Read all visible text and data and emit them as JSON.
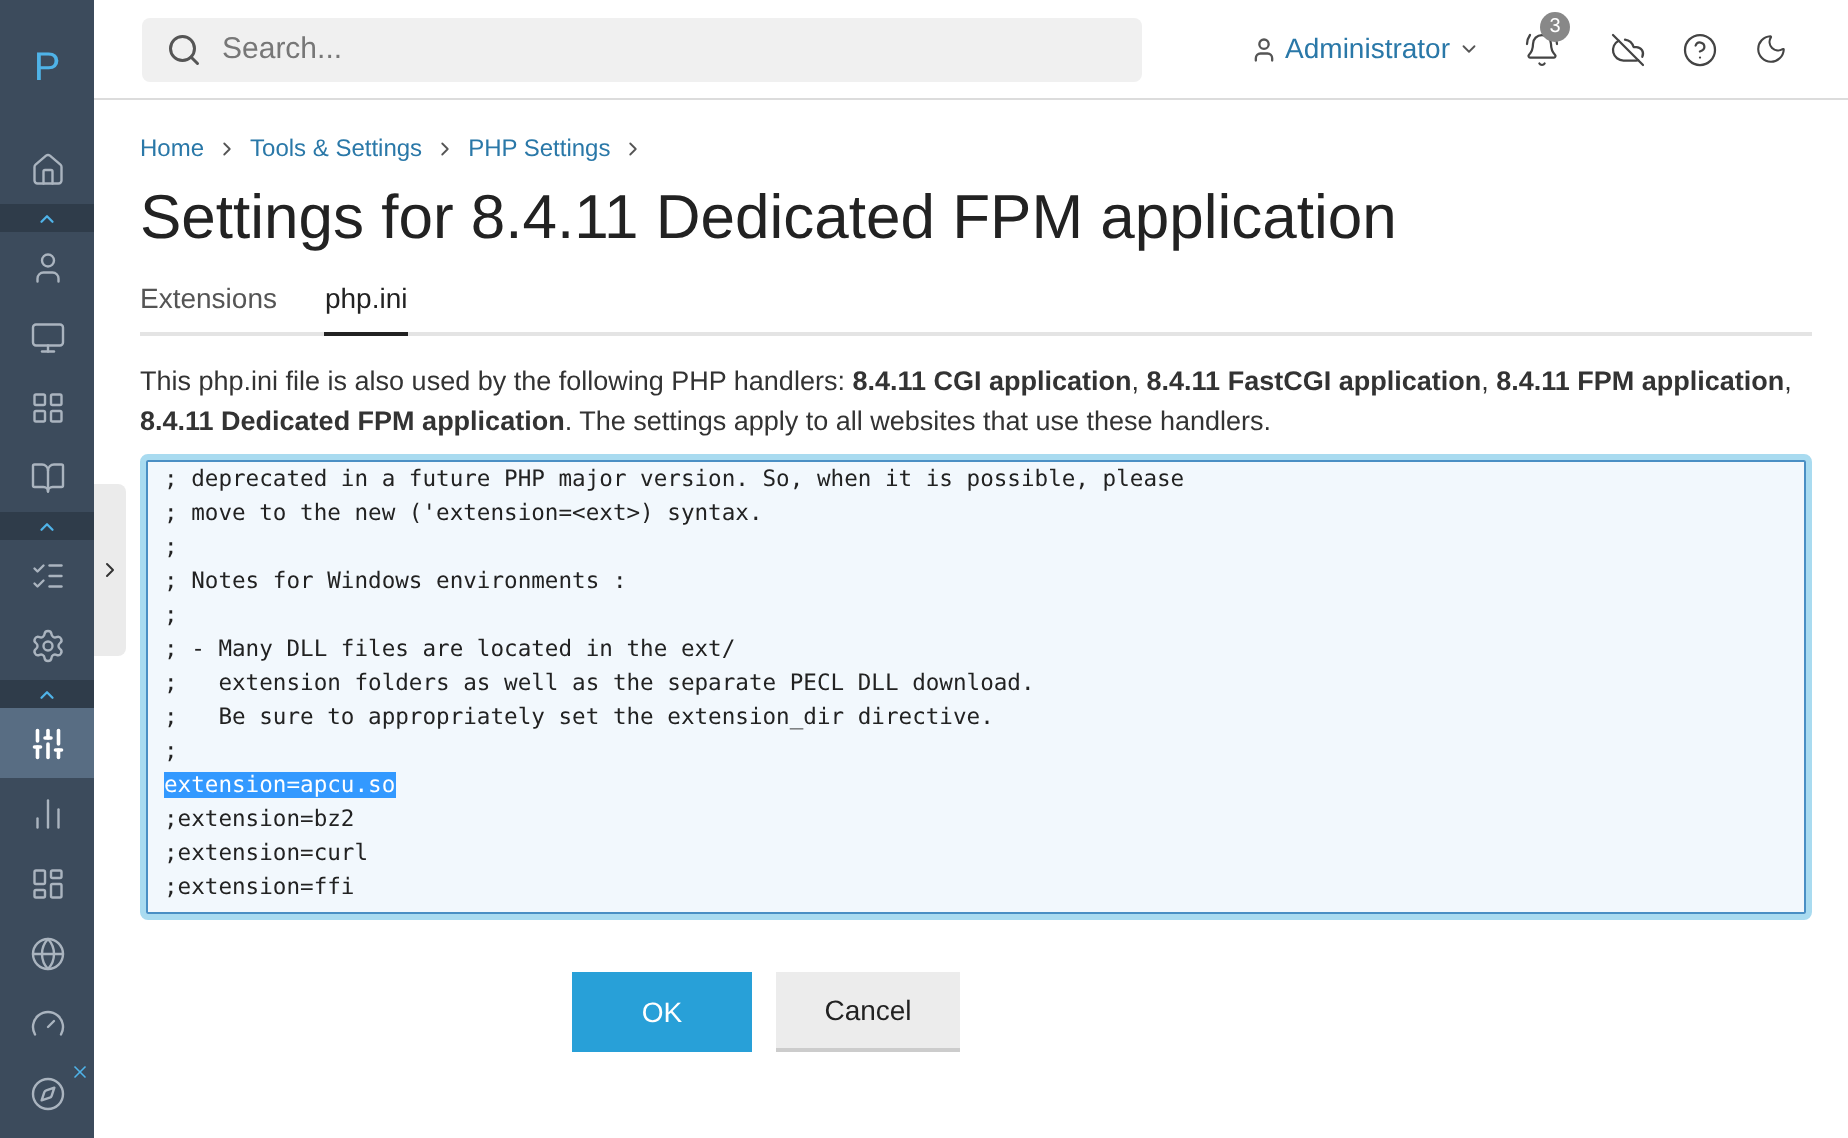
{
  "sidebar": {
    "logo": "P",
    "items": [
      {
        "kind": "nav",
        "selected": false
      },
      {
        "kind": "toggle",
        "selected": false
      },
      {
        "kind": "nav",
        "selected": false
      },
      {
        "kind": "nav",
        "selected": false
      },
      {
        "kind": "nav",
        "selected": false
      },
      {
        "kind": "nav",
        "selected": false
      },
      {
        "kind": "toggle",
        "selected": false
      },
      {
        "kind": "nav",
        "selected": false
      },
      {
        "kind": "nav",
        "selected": false
      },
      {
        "kind": "toggle",
        "selected": false
      },
      {
        "kind": "nav",
        "selected": true
      },
      {
        "kind": "nav",
        "selected": false
      },
      {
        "kind": "nav",
        "selected": false
      },
      {
        "kind": "nav",
        "selected": false
      },
      {
        "kind": "nav",
        "selected": false
      },
      {
        "kind": "nav",
        "selected": false
      }
    ]
  },
  "header": {
    "search": {
      "placeholder": "Search..."
    },
    "user": "Administrator",
    "notifications_count": "3"
  },
  "breadcrumbs": [
    "Home",
    "Tools & Settings",
    "PHP Settings"
  ],
  "title": "Settings for 8.4.11 Dedicated FPM application",
  "tabs": [
    {
      "label": "Extensions",
      "selected": false
    },
    {
      "label": "php.ini",
      "selected": true
    }
  ],
  "description": "This php.ini file is also used by the following PHP handlers: **8.4.11 CGI application**, **8.4.11 FastCGI application**, **8.4.11 FPM application**, **8.4.11 Dedicated FPM application**. The settings apply to all websites that use these handlers.",
  "editor": {
    "lines": [
      {
        "text": "; deprecated in a future PHP major version. So, when it is possible, please",
        "selected": false
      },
      {
        "text": "; move to the new ('extension=<ext>) syntax.",
        "selected": false
      },
      {
        "text": ";",
        "selected": false
      },
      {
        "text": "; Notes for Windows environments :",
        "selected": false
      },
      {
        "text": ";",
        "selected": false
      },
      {
        "text": "; - Many DLL files are located in the ext/",
        "selected": false
      },
      {
        "text": ";   extension folders as well as the separate PECL DLL download.",
        "selected": false
      },
      {
        "text": ";   Be sure to appropriately set the extension_dir directive.",
        "selected": false
      },
      {
        "text": ";",
        "selected": false
      },
      {
        "text": "extension=apcu.so",
        "selected": true
      },
      {
        "text": ";extension=bz2",
        "selected": false
      },
      {
        "text": ";extension=curl",
        "selected": false
      },
      {
        "text": ";extension=ffi",
        "selected": false
      }
    ]
  },
  "buttons": [
    {
      "label": "OK",
      "kind": "primary"
    },
    {
      "label": "Cancel",
      "kind": "secondary"
    }
  ]
}
